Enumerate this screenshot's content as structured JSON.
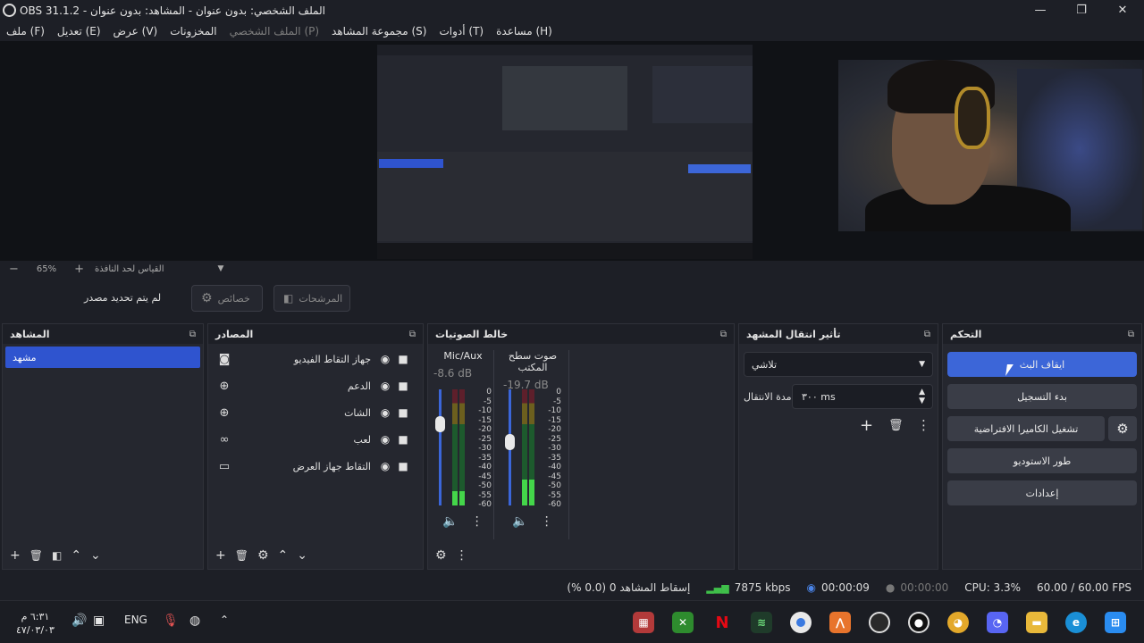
{
  "window": {
    "title": "OBS 31.1.2 - الملف الشخصي: بدون عنوان - المشاهد: بدون عنوان"
  },
  "menu": [
    {
      "label": "ملف (F)",
      "disabled": false
    },
    {
      "label": "تعديل (E)",
      "disabled": false
    },
    {
      "label": "عرض (V)",
      "disabled": false
    },
    {
      "label": "المخزونات",
      "disabled": false
    },
    {
      "label": "الملف الشخصي (P)",
      "disabled": true
    },
    {
      "label": "مجموعة المشاهد (S)",
      "disabled": false
    },
    {
      "label": "أدوات (T)",
      "disabled": false
    },
    {
      "label": "مساعدة (H)",
      "disabled": false
    }
  ],
  "zoom": {
    "minus": "−",
    "value": "65%",
    "plus": "+",
    "mode": "القياس لحد النافذة"
  },
  "source_toolbar": {
    "no_source": "لم يتم تحديد مصدر",
    "properties": "خصائص",
    "filters": "المرشحات"
  },
  "scenes": {
    "title": "المشاهد",
    "items": [
      "مشهد"
    ]
  },
  "sources": {
    "title": "المصادر",
    "items": [
      {
        "label": "جهاز التقاط الفيديو",
        "icon": "camera-icon"
      },
      {
        "label": "الدعم",
        "icon": "globe-icon"
      },
      {
        "label": "الشات",
        "icon": "globe-icon"
      },
      {
        "label": "لعب",
        "icon": "gamepad-icon"
      },
      {
        "label": "التقاط جهاز العرض",
        "icon": "monitor-icon"
      }
    ]
  },
  "mixer": {
    "title": "خالط الصوتيات",
    "channels": [
      {
        "name": "Mic/Aux",
        "db": "-8.6 dB",
        "level": 0.12,
        "fader": 0.7
      },
      {
        "name": "صوت سطح المكتب",
        "db": "-19.7 dB",
        "level": 0.22,
        "fader": 0.55
      }
    ],
    "ticks": [
      "0",
      "-5",
      "-10",
      "-15",
      "-20",
      "-25",
      "-30",
      "-35",
      "-40",
      "-45",
      "-50",
      "-55",
      "-60"
    ]
  },
  "transitions": {
    "title": "تأثير انتقال المشهد",
    "selected": "تلاشي",
    "duration_label": "مدة الانتقال",
    "duration_value": "٣٠٠ ms"
  },
  "controls": {
    "title": "التحكم",
    "stop_stream": "ايقاف البث",
    "start_record": "بدء التسجيل",
    "virtual_cam": "تشغيل الكاميرا الافتراضية",
    "studio_mode": "طور الاستوديو",
    "settings": "إعدادات"
  },
  "status": {
    "dropped": "إسقاط المشاهد 0 (0.0 %)",
    "kbps": "7875 kbps",
    "stream_time": "00:00:09",
    "record_time": "00:00:00",
    "cpu": "CPU: 3.3%",
    "fps": "60.00 / 60.00 FPS"
  },
  "taskbar": {
    "time": "٦:٣١ م",
    "date": "٤٧/٠٣/٠٣",
    "lang": "ENG"
  },
  "colors": {
    "accent": "#3c66d8",
    "panel": "#25272f",
    "bg": "#1d1f26"
  }
}
